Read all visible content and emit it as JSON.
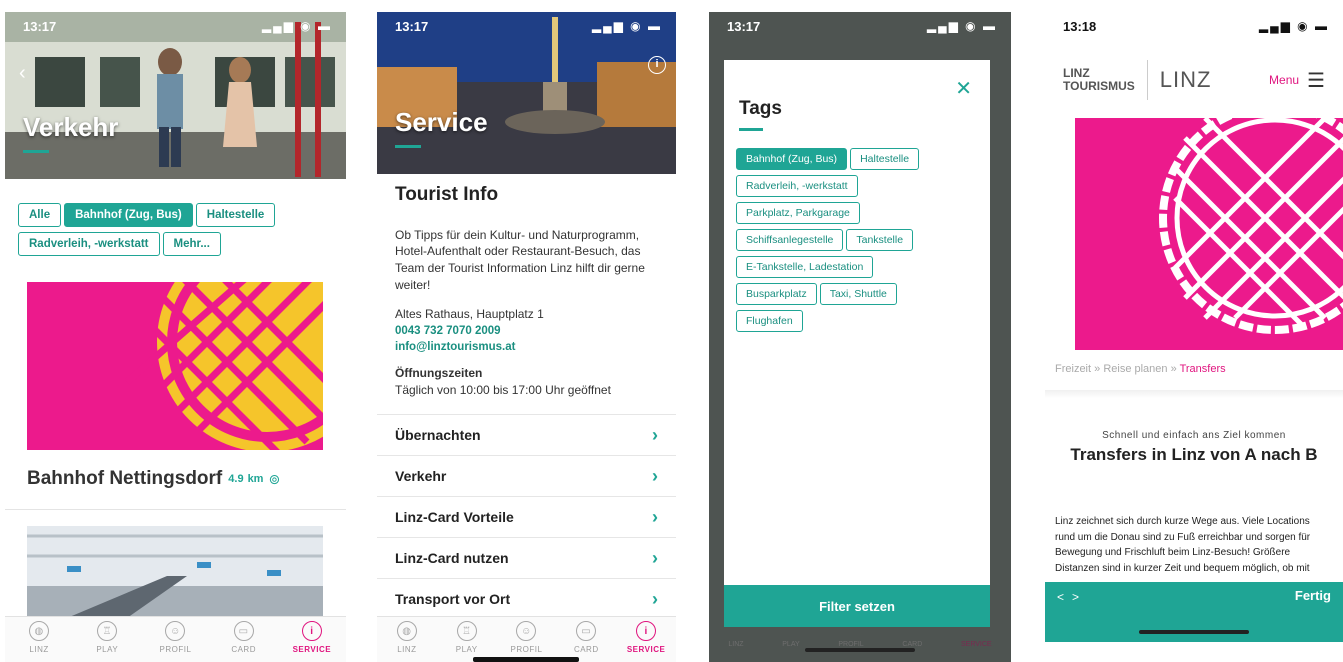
{
  "screen1": {
    "status_time": "13:17",
    "hero_title": "Verkehr",
    "tags": [
      {
        "label": "Alle",
        "active": false
      },
      {
        "label": "Bahnhof (Zug, Bus)",
        "active": true
      },
      {
        "label": "Haltestelle",
        "active": false
      },
      {
        "label": "Radverleih, -werkstatt",
        "active": false
      },
      {
        "label": "Mehr...",
        "active": false
      }
    ],
    "card_title": "Bahnhof Nettingsdorf",
    "card_distance": "4.9",
    "card_unit": "km",
    "tabs": [
      "LINZ",
      "PLAY",
      "PROFIL",
      "CARD",
      "SERVICE"
    ]
  },
  "screen2": {
    "status_time": "13:17",
    "hero_title": "Service",
    "info_title": "Tourist Info",
    "info_text": "Ob Tipps für dein Kultur- und Naturprogramm, Hotel-Aufenthalt oder Restaurant-Besuch, das Team der Tourist Information Linz hilft dir gerne weiter!",
    "address": "Altes Rathaus, Hauptplatz 1",
    "phone": "0043 732 7070 2009",
    "email": "info@linztourismus.at",
    "hours_label": "Öffnungszeiten",
    "hours_text": "Täglich von 10:00 bis 17:00 Uhr geöffnet",
    "menu": [
      "Übernachten",
      "Verkehr",
      "Linz-Card Vorteile",
      "Linz-Card nutzen",
      "Transport vor Ort"
    ],
    "tabs": [
      "LINZ",
      "PLAY",
      "PROFIL",
      "CARD",
      "SERVICE"
    ]
  },
  "screen3": {
    "status_time": "13:17",
    "title": "Tags",
    "tags": [
      {
        "label": "Bahnhof (Zug, Bus)",
        "active": true
      },
      {
        "label": "Haltestelle",
        "active": false
      },
      {
        "label": "Radverleih, -werkstatt",
        "active": false
      },
      {
        "label": "Parkplatz, Parkgarage",
        "active": false
      },
      {
        "label": "Schiffsanlegestelle",
        "active": false
      },
      {
        "label": "Tankstelle",
        "active": false
      },
      {
        "label": "E-Tankstelle, Ladestation",
        "active": false
      },
      {
        "label": "Busparkplatz",
        "active": false
      },
      {
        "label": "Taxi, Shuttle",
        "active": false
      },
      {
        "label": "Flughafen",
        "active": false
      }
    ],
    "filter_button": "Filter setzen",
    "tabs": [
      "LINZ",
      "PLAY",
      "PROFIL",
      "CARD",
      "SERVICE"
    ]
  },
  "screen4": {
    "status_time": "13:18",
    "logo_line1": "LINZ",
    "logo_line2": "TOURISMUS",
    "logo_right": "LINZ",
    "menu_label": "Menu",
    "breadcrumb_1": "Freizeit",
    "breadcrumb_2": "Reise planen",
    "breadcrumb_3": "Transfers",
    "kicker": "Schnell und einfach ans Ziel kommen",
    "title": "Transfers in Linz von A nach B",
    "body": "Linz zeichnet sich durch kurze Wege aus. Viele Locations rund um die Donau sind zu Fuß erreichbar und sorgen für Bewegung und Frischluft beim Linz-Besuch! Größere Distanzen sind in kurzer Zeit und bequem möglich, ob mit",
    "nav_prev": "<",
    "nav_next": ">",
    "done": "Fertig"
  },
  "colors": {
    "teal": "#1fa595",
    "pink": "#ec1a8c",
    "magenta_text": "#e0157f",
    "yellow": "#f5c52b"
  }
}
